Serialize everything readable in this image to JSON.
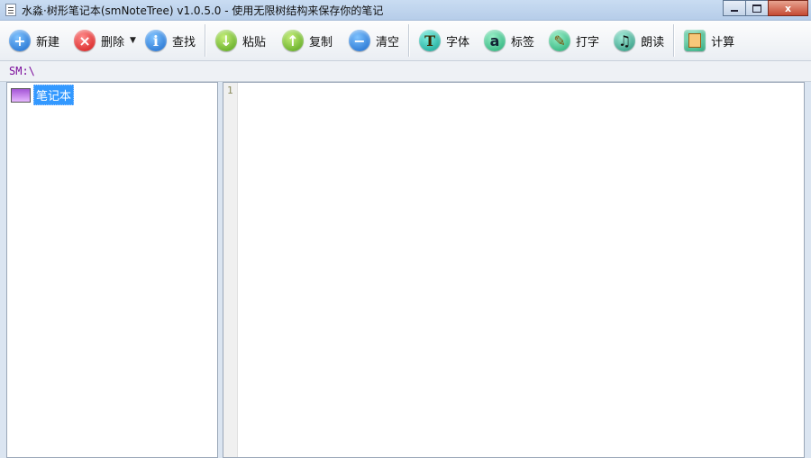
{
  "window": {
    "title": "水淼·树形笔记本(smNoteTree) v1.0.5.0 - 使用无限树结构来保存你的笔记",
    "buttons": {
      "min": "",
      "max": "",
      "close": "x"
    }
  },
  "toolbar": {
    "items": [
      {
        "label": "新建",
        "icon": "plus-circle-icon",
        "glyph": "+"
      },
      {
        "label": "删除",
        "icon": "close-circle-icon",
        "glyph": "×",
        "dropdown": "▼"
      },
      {
        "label": "查找",
        "icon": "info-icon",
        "glyph": "i"
      },
      {
        "label": "粘贴",
        "icon": "arrow-down-icon",
        "glyph": "↓"
      },
      {
        "label": "复制",
        "icon": "arrow-up-icon",
        "glyph": "↑"
      },
      {
        "label": "清空",
        "icon": "minus-circle-icon",
        "glyph": "−"
      },
      {
        "label": "字体",
        "icon": "font-icon",
        "glyph": "T"
      },
      {
        "label": "标签",
        "icon": "at-icon",
        "glyph": "a"
      },
      {
        "label": "打字",
        "icon": "pencil-icon",
        "glyph": "✎"
      },
      {
        "label": "朗读",
        "icon": "headphones-icon",
        "glyph": "♫"
      },
      {
        "label": "计算",
        "icon": "calculator-icon",
        "glyph": ""
      }
    ]
  },
  "path": {
    "text": "SM:\\"
  },
  "tree": {
    "nodes": [
      {
        "label": "笔记本",
        "icon": "notebook-icon",
        "selected": true
      }
    ]
  },
  "editor": {
    "line_numbers": [
      "1"
    ],
    "content": ""
  }
}
